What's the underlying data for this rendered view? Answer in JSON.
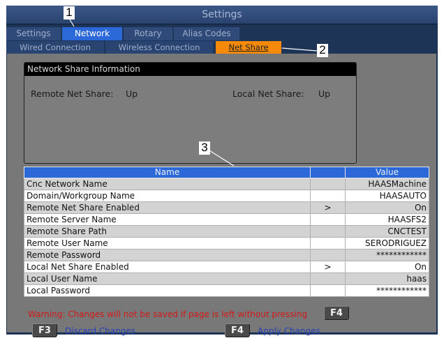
{
  "window": {
    "title": "Settings"
  },
  "tabs_primary": [
    "Settings",
    "Network",
    "Rotary",
    "Alias Codes"
  ],
  "tabs_secondary": [
    "Wired Connection",
    "Wireless Connection",
    "Net Share"
  ],
  "info_box": {
    "title": "Network Share Information",
    "remote_label": "Remote Net Share:",
    "remote_value": "Up",
    "local_label": "Local Net Share:",
    "local_value": "Up"
  },
  "table": {
    "headers": [
      "Name",
      "",
      "Value"
    ],
    "rows": [
      {
        "name": "Cnc Network Name",
        "mid": "",
        "value": "HAASMachine"
      },
      {
        "name": "Domain/Workgroup Name",
        "mid": "",
        "value": "HAASAUTO"
      },
      {
        "name": "Remote Net Share Enabled",
        "mid": ">",
        "value": "On"
      },
      {
        "name": "Remote Server Name",
        "mid": "",
        "value": "HAASFS2"
      },
      {
        "name": "Remote Share Path",
        "mid": "",
        "value": "CNCTEST"
      },
      {
        "name": "Remote User Name",
        "mid": "",
        "value": "SERODRIGUEZ"
      },
      {
        "name": "Remote Password",
        "mid": "",
        "value": "************"
      },
      {
        "name": "Local Net Share Enabled",
        "mid": ">",
        "value": "On"
      },
      {
        "name": "Local User Name",
        "mid": "",
        "value": "haas"
      },
      {
        "name": "Local Password",
        "mid": "",
        "value": "************"
      }
    ]
  },
  "footer": {
    "warning": "Warning: Changes will not be saved if page is left without pressing",
    "warning_key": "F4",
    "f3_key": "F3",
    "f3_label": "Discard Changes",
    "f4_key": "F4",
    "f4_label": "Apply Changes"
  },
  "callouts": [
    "1",
    "2",
    "3"
  ],
  "colors": {
    "frame": "#1e3456",
    "tab_active": "#2d68d8",
    "subtab_active": "#f58a0a",
    "warning": "#d21919",
    "action_label": "#203fb5"
  }
}
